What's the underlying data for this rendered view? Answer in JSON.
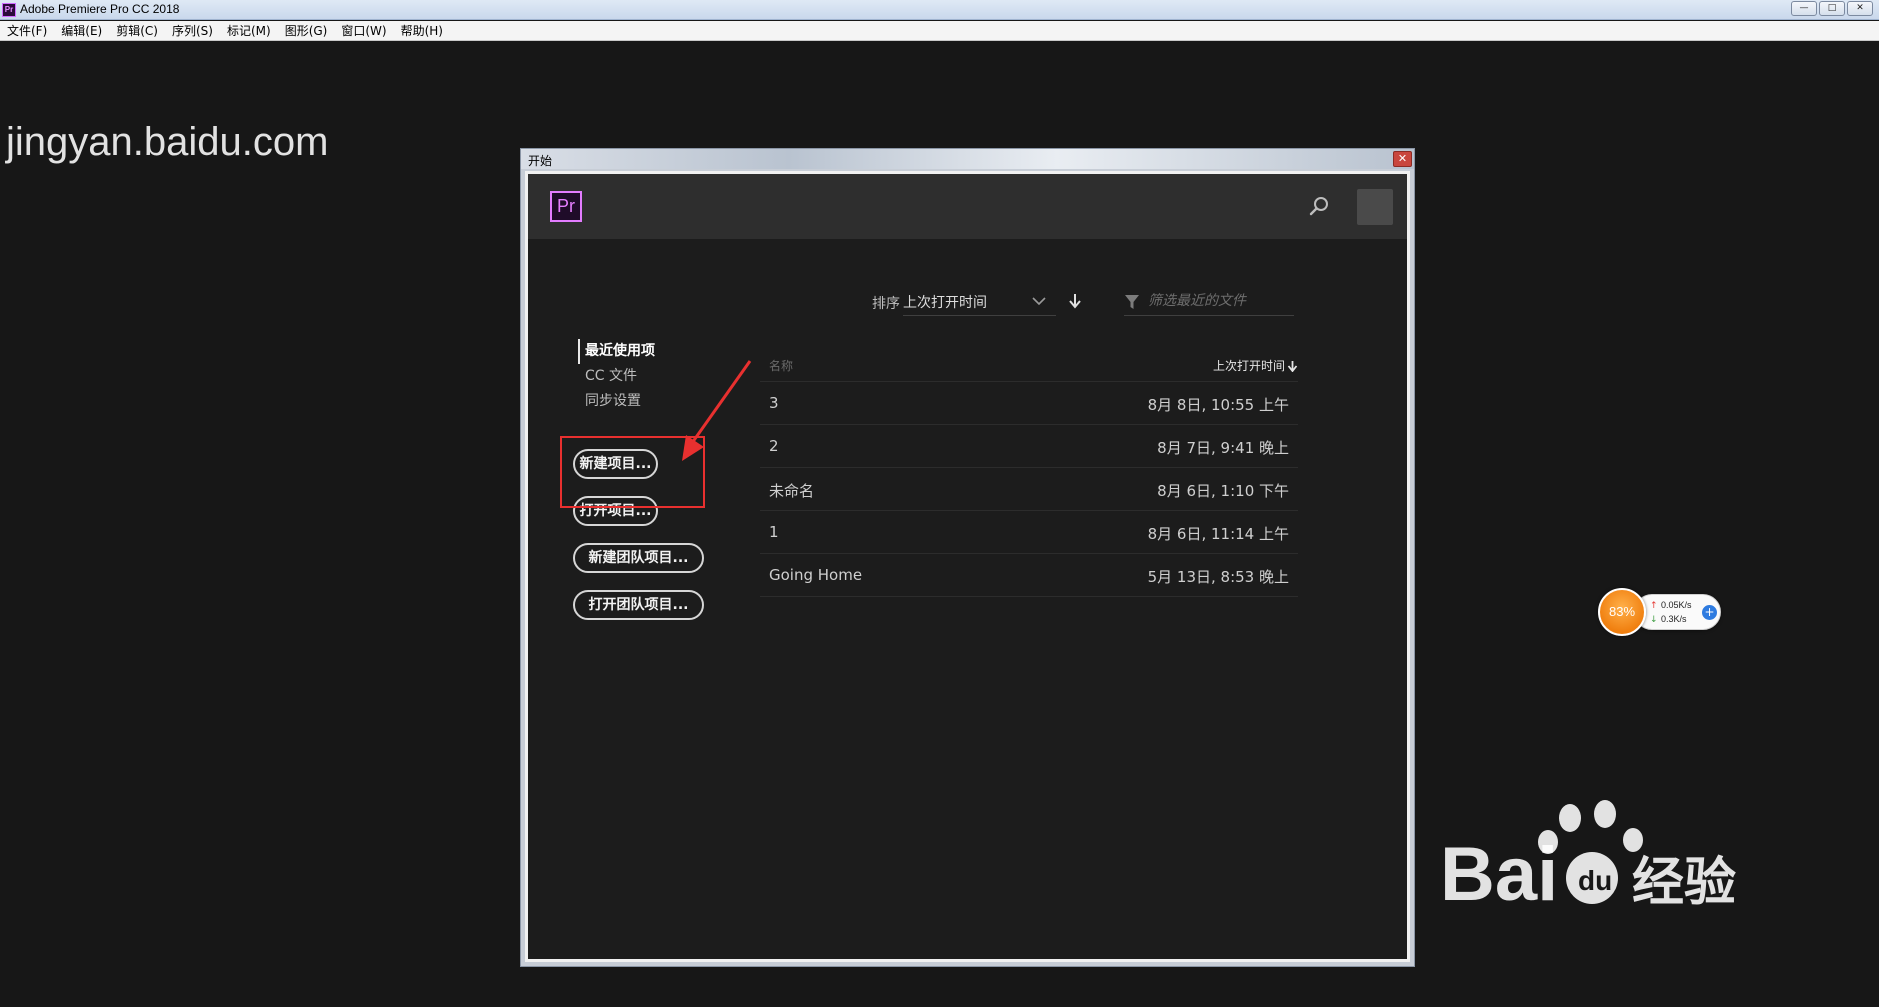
{
  "app": {
    "title": "Adobe Premiere Pro CC 2018",
    "icon": "Pr",
    "window_controls": [
      "minimize",
      "maximize",
      "close"
    ]
  },
  "menubar": {
    "items": [
      "文件(F)",
      "编辑(E)",
      "剪辑(C)",
      "序列(S)",
      "标记(M)",
      "图形(G)",
      "窗口(W)",
      "帮助(H)"
    ]
  },
  "dialog": {
    "title": "开始",
    "logo": "Pr",
    "sort_label": "排序",
    "sort_value": "上次打开时间",
    "filter_placeholder": "筛选最近的文件",
    "nav": [
      "最近使用项",
      "CC 文件",
      "同步设置"
    ],
    "buttons": {
      "new_project": "新建项目...",
      "open_project": "打开项目...",
      "new_team_project": "新建团队项目...",
      "open_team_project": "打开团队项目..."
    },
    "table": {
      "col_name": "名称",
      "col_date": "上次打开时间",
      "rows": [
        {
          "name": "3",
          "date": "8月 8日, 10:55 上午"
        },
        {
          "name": "2",
          "date": "8月 7日, 9:41 晚上"
        },
        {
          "name": "未命名",
          "date": "8月 6日, 1:10 下午"
        },
        {
          "name": "1",
          "date": "8月 6日, 11:14 上午"
        },
        {
          "name": "Going Home",
          "date": "5月 13日, 8:53 晚上"
        }
      ]
    }
  },
  "net_widget": {
    "percent": "83%",
    "upload": "0.05K/s",
    "download": "0.3K/s"
  },
  "watermark": {
    "url": "jingyan.baidu.com"
  },
  "colors": {
    "background": "#171717",
    "panel": "#1c1c1c",
    "header": "#2e2e2e",
    "pr_purple": "#e37cff",
    "annotation_red": "#e8302f",
    "gauge_orange": "#f07f0f"
  }
}
